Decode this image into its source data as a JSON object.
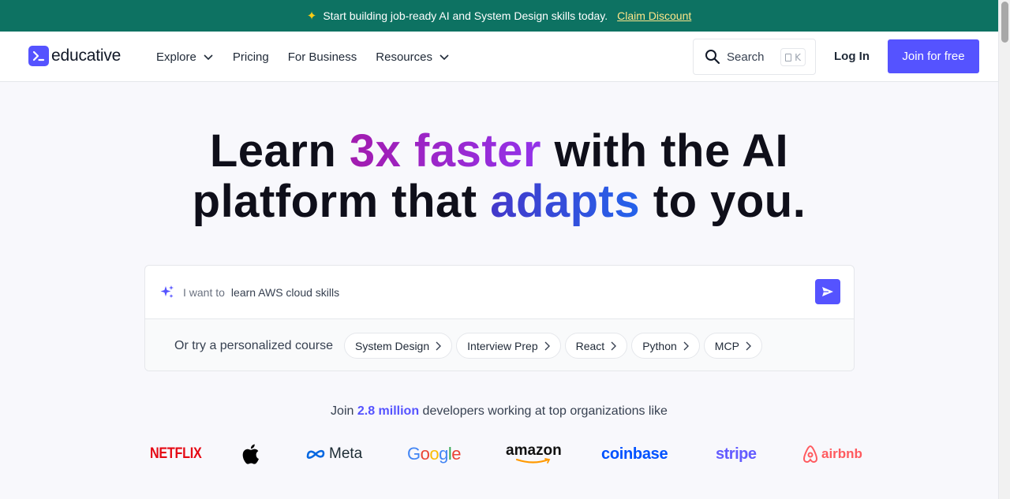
{
  "banner": {
    "message": "Start building job-ready AI and System Design skills today.",
    "cta": "Claim Discount"
  },
  "header": {
    "logo_text": "educative",
    "nav": [
      {
        "label": "Explore",
        "has_dropdown": true
      },
      {
        "label": "Pricing",
        "has_dropdown": false
      },
      {
        "label": "For Business",
        "has_dropdown": false
      },
      {
        "label": "Resources",
        "has_dropdown": true
      }
    ],
    "search_label": "Search",
    "search_shortcut": "K",
    "login": "Log In",
    "join": "Join for free"
  },
  "hero": {
    "part1": "Learn ",
    "highlight1": "3x faster",
    "part2": " with the AI",
    "part3": "platform that ",
    "highlight2": "adapts",
    "part4": " to you."
  },
  "prompt": {
    "prefix": "I want to",
    "value": "learn AWS cloud skills",
    "suggest_label": "Or try a personalized course",
    "chips": [
      "System Design",
      "Interview Prep",
      "React",
      "Python",
      "MCP"
    ]
  },
  "social_proof": {
    "before": "Join ",
    "count": "2.8 million",
    "after": " developers working at top organizations like"
  },
  "brands": [
    "NETFLIX",
    "Apple",
    "Meta",
    "Google",
    "amazon",
    "coinbase",
    "stripe",
    "airbnb"
  ],
  "colors": {
    "banner_bg": "#0d7262",
    "accent": "#5553ff",
    "highlight_purple": "#a21caf",
    "highlight_blue": "#3b4fd8"
  }
}
